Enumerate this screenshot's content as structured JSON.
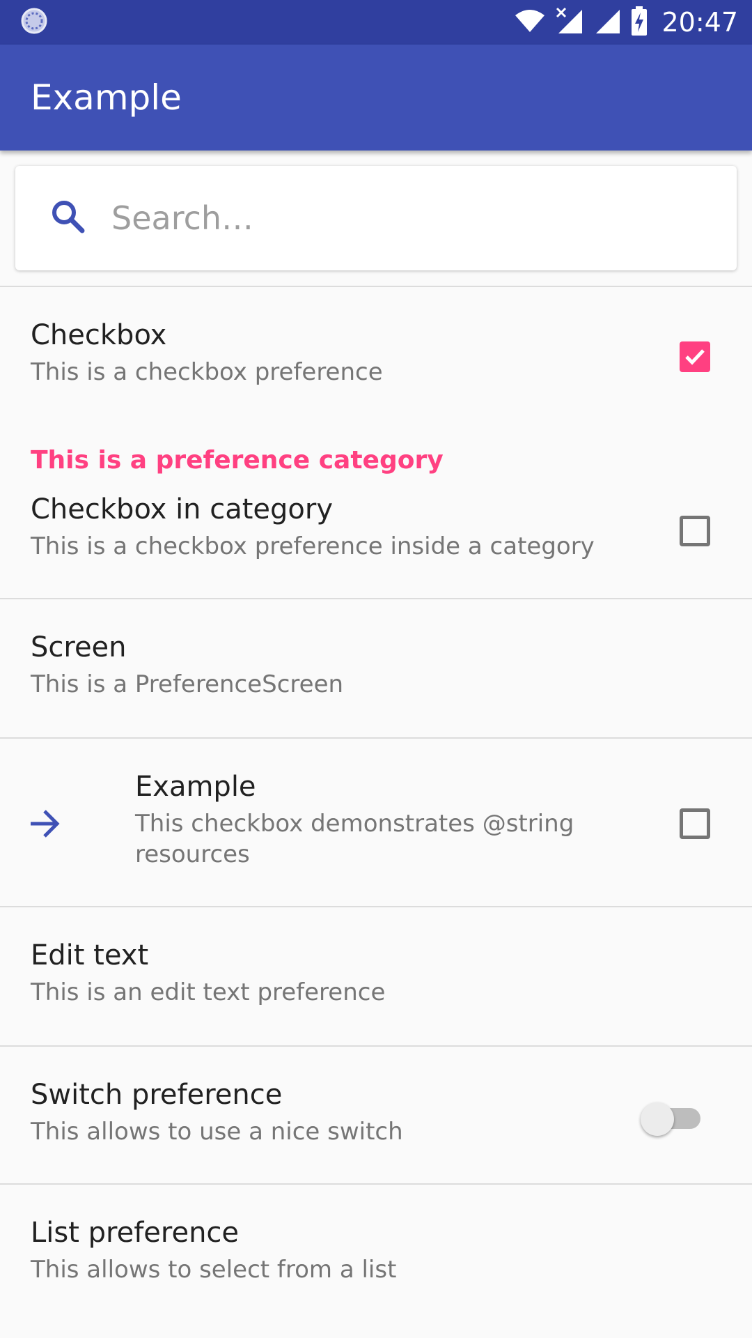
{
  "status_bar": {
    "time": "20:47"
  },
  "app_bar": {
    "title": "Example"
  },
  "search": {
    "placeholder": "Search…"
  },
  "prefs": {
    "checkbox": {
      "title": "Checkbox",
      "summary": "This is a checkbox preference",
      "checked": true
    },
    "category_header": "This is a preference category",
    "checkbox_in_category": {
      "title": "Checkbox in category",
      "summary": "This is a checkbox preference inside a category",
      "checked": false
    },
    "screen": {
      "title": "Screen",
      "summary": "This is a PreferenceScreen"
    },
    "example": {
      "title": "Example",
      "summary": "This checkbox demonstrates @string resources",
      "checked": false,
      "icon": "arrow-right-icon"
    },
    "edit_text": {
      "title": "Edit text",
      "summary": "This is an edit text preference"
    },
    "switch": {
      "title": "Switch preference",
      "summary": "This allows to use a nice switch",
      "on": false
    },
    "list": {
      "title": "List preference",
      "summary": "This allows to select from a list"
    }
  },
  "colors": {
    "primary": "#3f51b5",
    "primary_dark": "#303f9f",
    "accent": "#ff4081"
  }
}
